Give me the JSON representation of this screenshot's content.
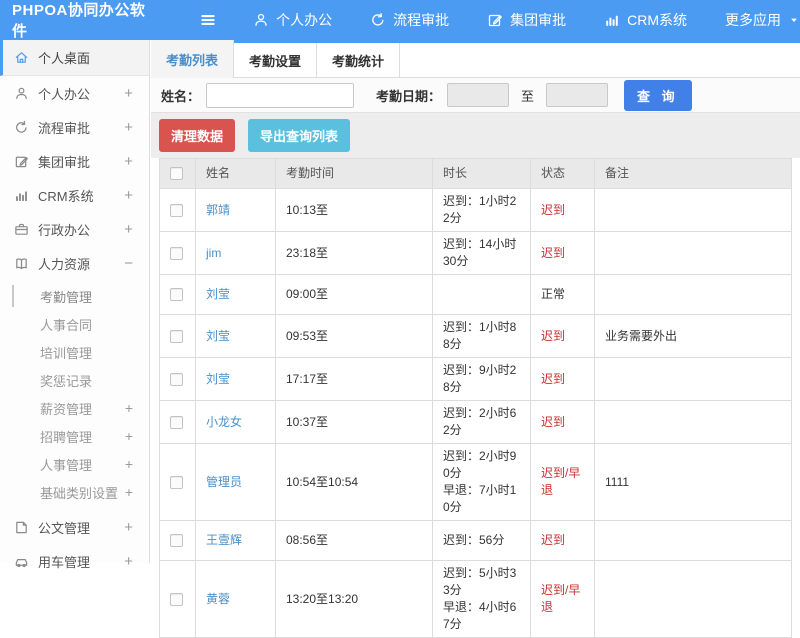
{
  "colors": {
    "header": "#4c9bf2",
    "link": "#4a8fc9",
    "alert": "#c9302c",
    "btn_danger": "#d9534f",
    "btn_info": "#5bc0de",
    "btn_primary": "#4080e8"
  },
  "header": {
    "title": "PHPOA协同办公软件",
    "nav": [
      {
        "key": "personal-office",
        "icon": "user-icon",
        "label": "个人办公"
      },
      {
        "key": "workflow-approval",
        "icon": "redo-icon",
        "label": "流程审批"
      },
      {
        "key": "group-approval",
        "icon": "edit-icon",
        "label": "集团审批"
      },
      {
        "key": "crm-system",
        "icon": "chart-icon",
        "label": "CRM系统"
      },
      {
        "key": "more-apps",
        "icon": "",
        "label": "更多应用",
        "caret": true
      }
    ]
  },
  "sidebar": {
    "items": [
      {
        "key": "personal-desktop",
        "icon": "home-icon",
        "label": "个人桌面",
        "active": true
      },
      {
        "key": "personal-office",
        "icon": "user-icon",
        "label": "个人办公",
        "toggle": "+"
      },
      {
        "key": "workflow-approval",
        "icon": "redo-icon",
        "label": "流程审批",
        "toggle": "+"
      },
      {
        "key": "group-approval",
        "icon": "edit-icon",
        "label": "集团审批",
        "toggle": "+"
      },
      {
        "key": "crm-system",
        "icon": "chart-icon",
        "label": "CRM系统",
        "toggle": "+"
      },
      {
        "key": "admin-office",
        "icon": "briefcase-icon",
        "label": "行政办公",
        "toggle": "+"
      },
      {
        "key": "human-resources",
        "icon": "book-icon",
        "label": "人力资源",
        "toggle": "−",
        "children": [
          {
            "key": "attendance-management",
            "label": "考勤管理",
            "active": true
          },
          {
            "key": "hr-contract",
            "label": "人事合同"
          },
          {
            "key": "training-management",
            "label": "培训管理"
          },
          {
            "key": "reward-punishment",
            "label": "奖惩记录"
          },
          {
            "key": "salary-management",
            "label": "薪资管理",
            "toggle": "+"
          },
          {
            "key": "recruitment-management",
            "label": "招聘管理",
            "toggle": "+"
          },
          {
            "key": "personnel-management",
            "label": "人事管理",
            "toggle": "+"
          },
          {
            "key": "base-category-settings",
            "label": "基础类别设置",
            "toggle": "+"
          }
        ]
      },
      {
        "key": "document-management",
        "icon": "doc-icon",
        "label": "公文管理",
        "toggle": "+"
      },
      {
        "key": "vehicle-management",
        "icon": "car-icon",
        "label": "用车管理",
        "toggle": "+"
      }
    ]
  },
  "tabs": [
    {
      "key": "attendance-list",
      "label": "考勤列表",
      "active": true
    },
    {
      "key": "attendance-settings",
      "label": "考勤设置",
      "active": false
    },
    {
      "key": "attendance-stats",
      "label": "考勤统计",
      "active": false
    }
  ],
  "filter": {
    "name_label": "姓名：",
    "name_value": "",
    "date_label": "考勤日期：",
    "date_from": "",
    "to_label": "至",
    "date_to": "",
    "search_label": "查 询"
  },
  "toolbar": {
    "clean_label": "清理数据",
    "export_label": "导出查询列表"
  },
  "table": {
    "headers": [
      "姓名",
      "考勤时间",
      "时长",
      "状态",
      "备注"
    ],
    "rows": [
      {
        "name": "郭靖",
        "time": "10:13至",
        "duration": [
          "迟到：1小时22分"
        ],
        "status": "迟到",
        "alert": true,
        "note": ""
      },
      {
        "name": "jim",
        "time": "23:18至",
        "duration": [
          "迟到：14小时30分"
        ],
        "status": "迟到",
        "alert": true,
        "note": ""
      },
      {
        "name": "刘莹",
        "time": "09:00至",
        "duration": [],
        "status": "正常",
        "alert": false,
        "note": ""
      },
      {
        "name": "刘莹",
        "time": "09:53至",
        "duration": [
          "迟到：1小时88分"
        ],
        "status": "迟到",
        "alert": true,
        "note": "业务需要外出"
      },
      {
        "name": "刘莹",
        "time": "17:17至",
        "duration": [
          "迟到：9小时28分"
        ],
        "status": "迟到",
        "alert": true,
        "note": ""
      },
      {
        "name": "小龙女",
        "time": "10:37至",
        "duration": [
          "迟到：2小时62分"
        ],
        "status": "迟到",
        "alert": true,
        "note": ""
      },
      {
        "name": "管理员",
        "time": "10:54至10:54",
        "duration": [
          "迟到：2小时90分",
          "早退：7小时10分"
        ],
        "status": "迟到/早退",
        "alert": true,
        "note": "1111"
      },
      {
        "name": "王壹辉",
        "time": "08:56至",
        "duration": [
          "迟到：56分"
        ],
        "status": "迟到",
        "alert": true,
        "note": ""
      },
      {
        "name": "黄蓉",
        "time": "13:20至13:20",
        "duration": [
          "迟到：5小时33分",
          "早退：4小时67分"
        ],
        "status": "迟到/早退",
        "alert": true,
        "note": ""
      }
    ]
  }
}
